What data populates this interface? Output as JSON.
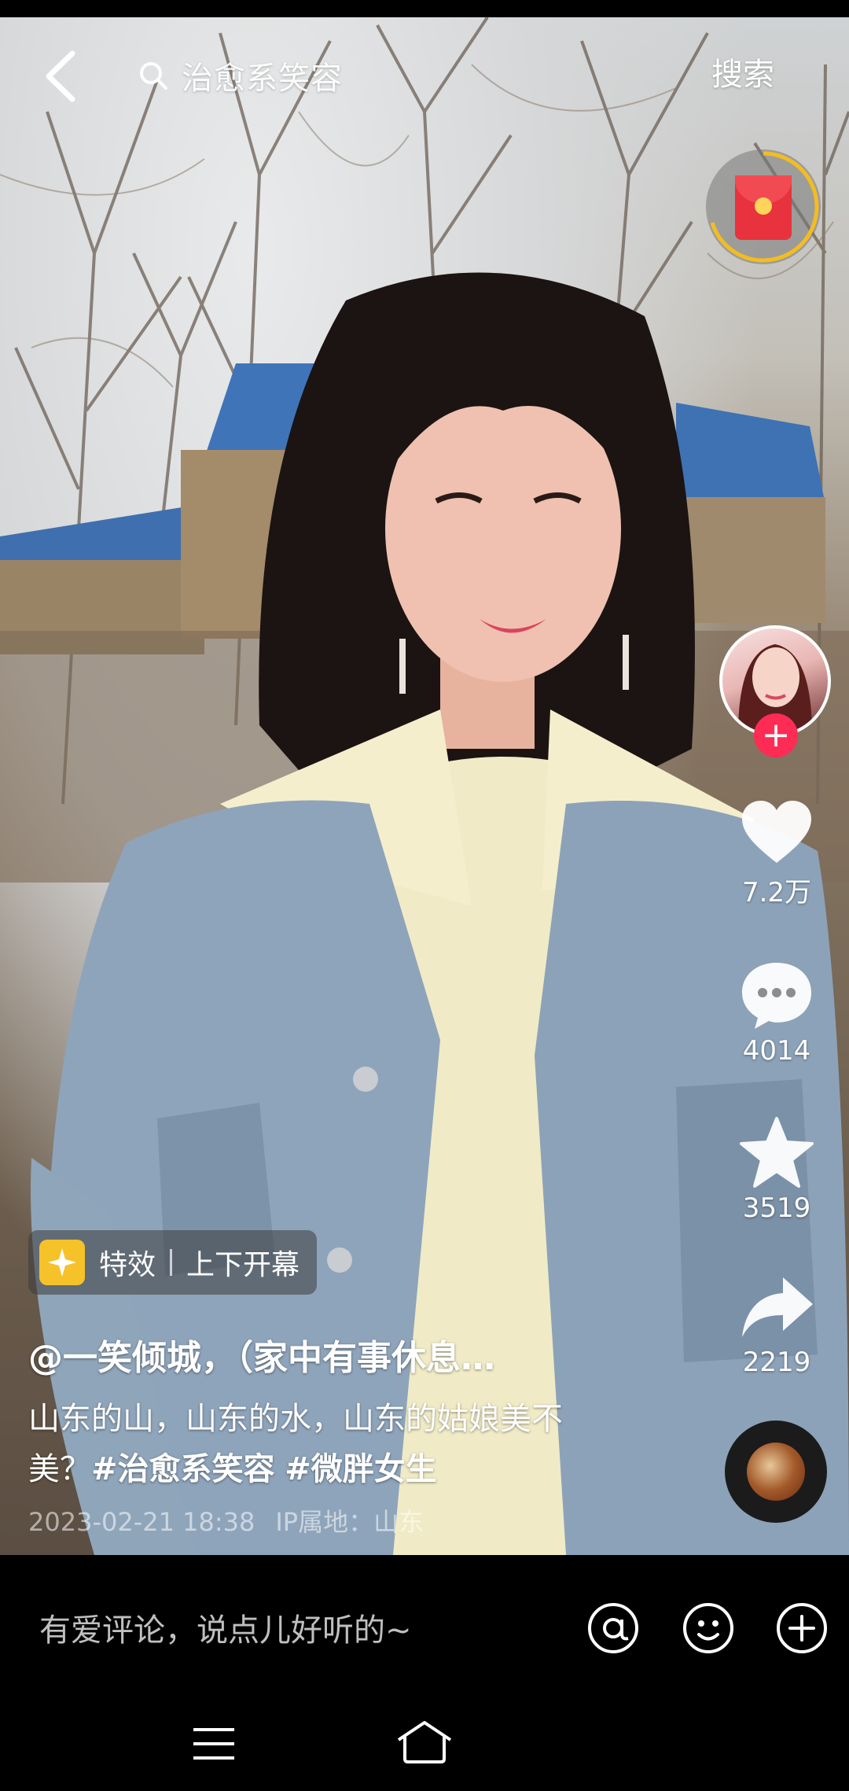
{
  "search": {
    "query": "治愈系笑容",
    "button_label": "搜索"
  },
  "actions": {
    "likes": "7.2万",
    "comments": "4014",
    "favorites": "3519",
    "shares": "2219"
  },
  "effect": {
    "label": "特效",
    "name": "上下开幕"
  },
  "caption": {
    "author": "@一笑倾城，（家中有事休息…",
    "text_line1": "山东的山，山东的水，山东的姑娘美不",
    "text_line2_prefix": "美？",
    "tag1": "#治愈系笑容",
    "tag2": "#微胖女生",
    "date": "2023-02-21 18:38",
    "ip_location": "IP属地：山东"
  },
  "comment": {
    "placeholder": "有爱评论，说点儿好听的~"
  },
  "colors": {
    "follow": "#fe2c55",
    "red_packet": "#e8323d",
    "effect_icon": "#f5c22a"
  },
  "icons": [
    "back-icon",
    "search-icon",
    "red-packet-icon",
    "heart-icon",
    "comment-icon",
    "star-icon",
    "share-icon",
    "at-icon",
    "emoji-icon",
    "plus-icon",
    "menu-icon",
    "home-icon"
  ]
}
